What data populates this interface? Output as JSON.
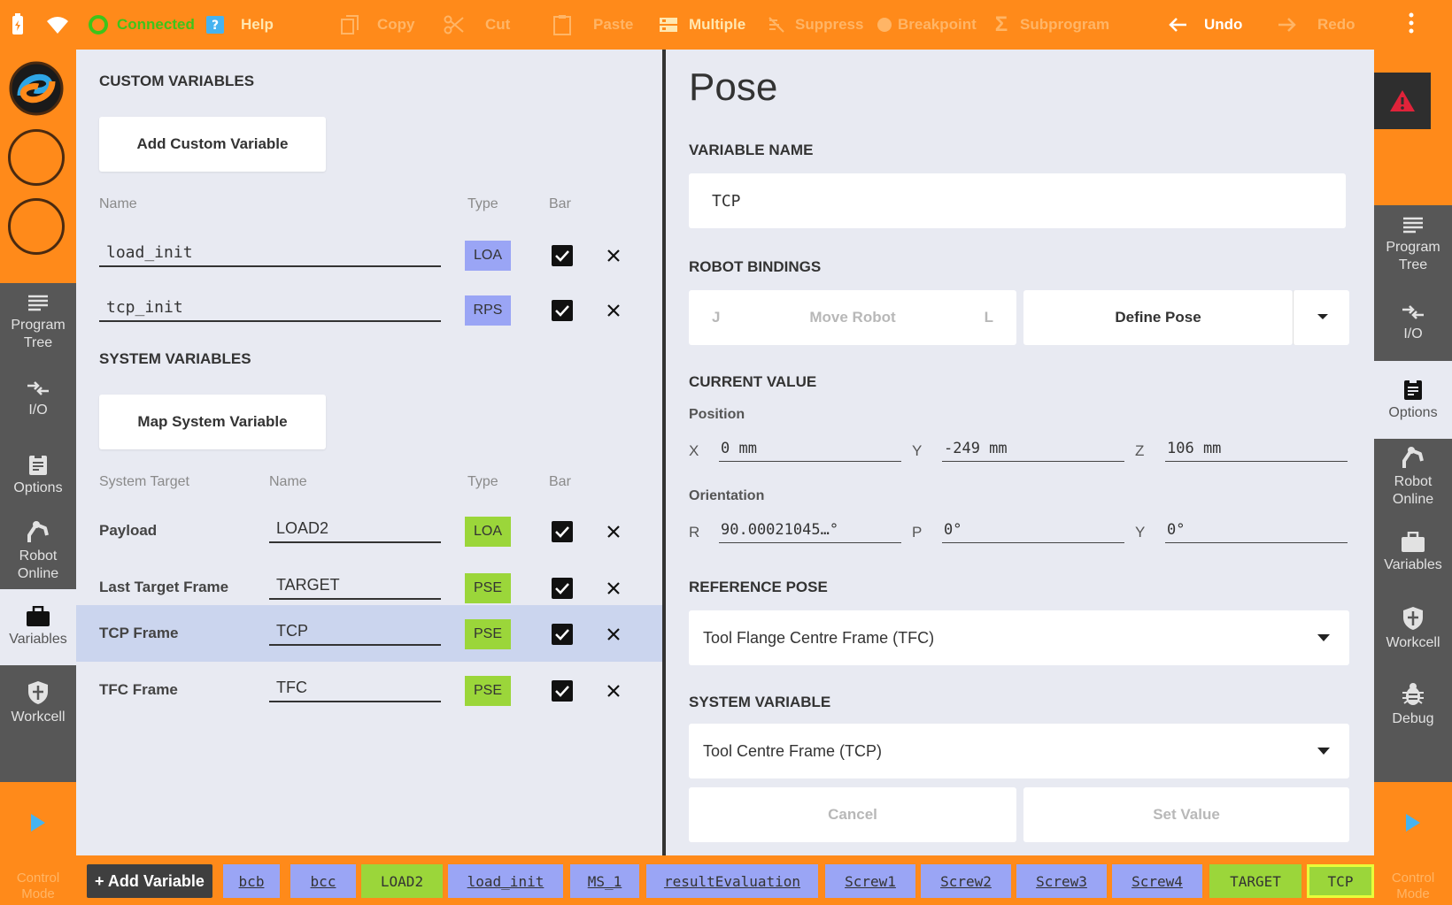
{
  "topbar": {
    "connected": "Connected",
    "help": "Help",
    "copy": "Copy",
    "cut": "Cut",
    "paste": "Paste",
    "multiple": "Multiple",
    "suppress": "Suppress",
    "breakpoint": "Breakpoint",
    "subprogram": "Subprogram",
    "undo": "Undo",
    "redo": "Redo"
  },
  "left_nav": [
    {
      "label": "Program Tree",
      "icon": "list-icon"
    },
    {
      "label": "I/O",
      "icon": "io-arrows-icon"
    },
    {
      "label": "Options",
      "icon": "clipboard-icon"
    },
    {
      "label": "Robot Online",
      "icon": "robot-arm-icon"
    },
    {
      "label": "Variables",
      "icon": "briefcase-icon",
      "active": true
    },
    {
      "label": "Workcell",
      "icon": "shield-icon"
    }
  ],
  "right_nav": [
    {
      "label": "Program Tree",
      "icon": "list-icon"
    },
    {
      "label": "I/O",
      "icon": "io-arrows-icon"
    },
    {
      "label": "Options",
      "icon": "clipboard-icon",
      "active": true
    },
    {
      "label": "Robot Online",
      "icon": "robot-arm-icon"
    },
    {
      "label": "Variables",
      "icon": "briefcase-icon"
    },
    {
      "label": "Workcell",
      "icon": "shield-icon"
    },
    {
      "label": "Debug",
      "icon": "bug-icon"
    }
  ],
  "control_mode": "Control Mode",
  "custom": {
    "title": "CUSTOM VARIABLES",
    "add_button": "Add Custom Variable",
    "headers": {
      "name": "Name",
      "type": "Type",
      "bar": "Bar"
    },
    "rows": [
      {
        "name": "load_init",
        "type": "LOA"
      },
      {
        "name": "tcp_init",
        "type": "RPS"
      }
    ]
  },
  "system": {
    "title": "SYSTEM VARIABLES",
    "map_button": "Map System Variable",
    "headers": {
      "target": "System Target",
      "name": "Name",
      "type": "Type",
      "bar": "Bar"
    },
    "rows": [
      {
        "target": "Payload",
        "name": "LOAD2",
        "type": "LOA"
      },
      {
        "target": "Last Target Frame",
        "name": "TARGET",
        "type": "PSE"
      },
      {
        "target": "TCP Frame",
        "name": "TCP",
        "type": "PSE",
        "selected": true
      },
      {
        "target": "TFC Frame",
        "name": "TFC",
        "type": "PSE"
      }
    ]
  },
  "pose": {
    "title": "Pose",
    "variable_name_label": "VARIABLE NAME",
    "variable_name": "TCP",
    "robot_bindings_label": "ROBOT BINDINGS",
    "move_j": "J",
    "move_robot": "Move Robot",
    "move_l": "L",
    "define_pose": "Define Pose",
    "current_value_label": "CURRENT VALUE",
    "position_label": "Position",
    "position": {
      "x_label": "X",
      "x": "0 mm",
      "y_label": "Y",
      "y": "-249 mm",
      "z_label": "Z",
      "z": "106 mm"
    },
    "orientation_label": "Orientation",
    "orientation": {
      "r_label": "R",
      "r": "90.00021045…°",
      "p_label": "P",
      "p": "0°",
      "y_label": "Y",
      "y": "0°"
    },
    "reference_pose_label": "REFERENCE POSE",
    "reference_pose": "Tool Flange Centre Frame (TFC)",
    "system_variable_label": "SYSTEM VARIABLE",
    "system_variable": "Tool Centre Frame (TCP)",
    "cancel": "Cancel",
    "set_value": "Set Value"
  },
  "bottombar": {
    "add_variable": "+ Add Variable",
    "chips": [
      {
        "label": "bcb",
        "kind": "blue"
      },
      {
        "label": "bcc",
        "kind": "blue"
      },
      {
        "label": "LOAD2",
        "kind": "green"
      },
      {
        "label": "load_init",
        "kind": "blue"
      },
      {
        "label": "MS_1",
        "kind": "blue"
      },
      {
        "label": "resultEvaluation",
        "kind": "blue"
      },
      {
        "label": "Screw1",
        "kind": "blue"
      },
      {
        "label": "Screw2",
        "kind": "blue"
      },
      {
        "label": "Screw3",
        "kind": "blue"
      },
      {
        "label": "Screw4",
        "kind": "blue"
      },
      {
        "label": "TARGET",
        "kind": "green"
      },
      {
        "label": "TCP",
        "kind": "green",
        "selected": true
      }
    ]
  },
  "colors": {
    "accent_orange": "#ff8a1a",
    "sidebar_gray": "#575757",
    "panel_bg": "#e8eaf2",
    "tag_blue": "#9aa5f5",
    "tag_green": "#9bd63a",
    "selected_row": "#cbd5ee",
    "connected_green": "#3ec41a"
  }
}
